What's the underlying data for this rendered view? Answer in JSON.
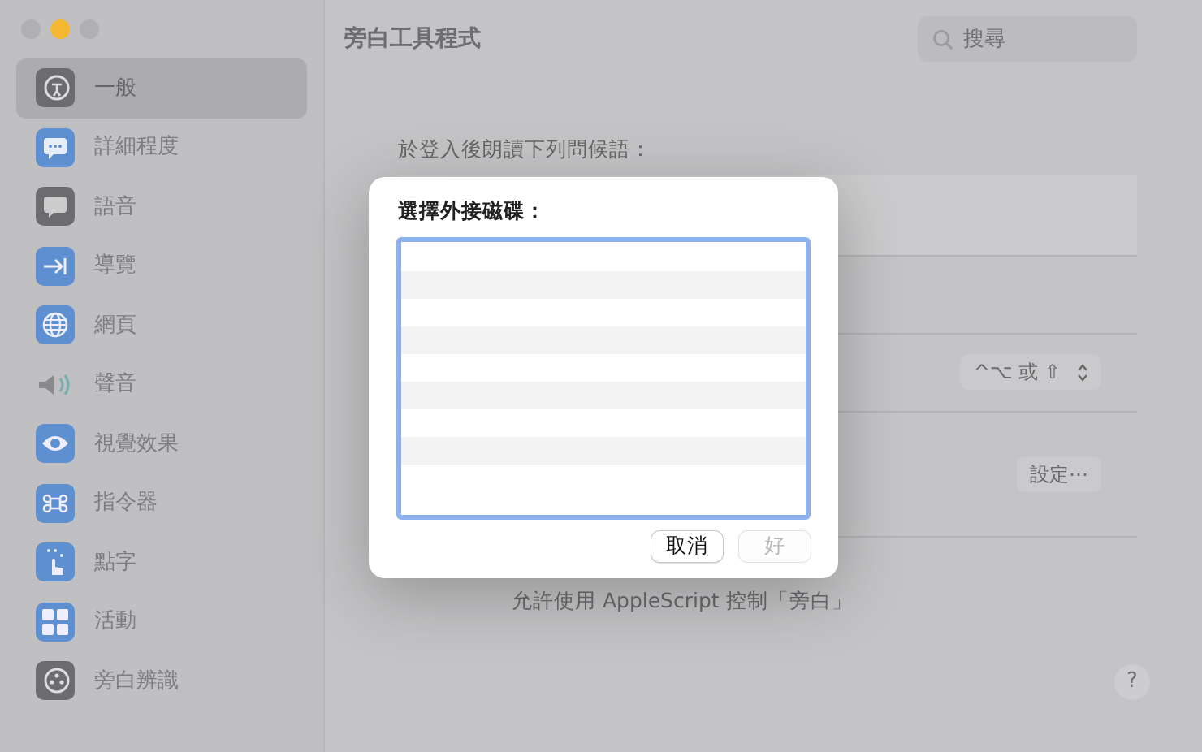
{
  "window": {
    "title": "旁白工具程式",
    "controls": [
      {
        "active": false
      },
      {
        "active": true
      },
      {
        "active": false
      }
    ]
  },
  "search": {
    "placeholder": "搜尋"
  },
  "sidebar": {
    "items": [
      {
        "label": "一般",
        "selected": true
      },
      {
        "label": "詳細程度",
        "selected": false
      },
      {
        "label": "語音",
        "selected": false
      },
      {
        "label": "導覽",
        "selected": false
      },
      {
        "label": "網頁",
        "selected": false
      },
      {
        "label": "聲音",
        "selected": false
      },
      {
        "label": "視覺效果",
        "selected": false
      },
      {
        "label": "指令器",
        "selected": false
      },
      {
        "label": "點字",
        "selected": false
      },
      {
        "label": "活動",
        "selected": false
      },
      {
        "label": "旁白辨識",
        "selected": false
      }
    ]
  },
  "greeting": {
    "label": "於登入後朗讀下列問候語："
  },
  "modifier_popup": {
    "value": "^⌥ 或 ⇧"
  },
  "settings_button": {
    "label": "設定⋯"
  },
  "applescript_option": {
    "label": "允許使用 AppleScript 控制「旁白」"
  },
  "help_button": {
    "label": "?"
  },
  "dialog": {
    "title": "選擇外接磁碟：",
    "buttons": [
      {
        "label": "取消",
        "disabled": false
      },
      {
        "label": "好",
        "disabled": true
      }
    ]
  }
}
